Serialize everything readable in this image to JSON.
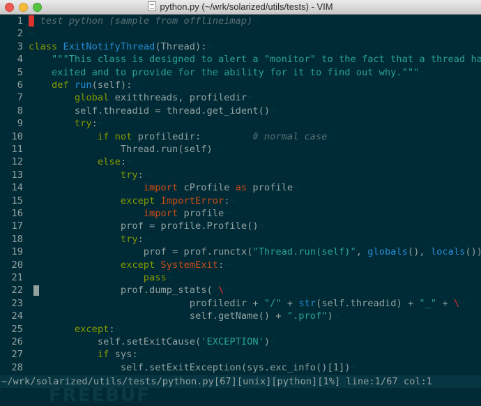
{
  "window": {
    "title": "python.py (~/wrk/solarized/utils/tests) - VIM",
    "file_icon": "document-icon"
  },
  "editor": {
    "lines": [
      {
        "n": "1",
        "segs": [
          [
            "cursor",
            "#"
          ],
          [
            "c",
            " test python (sample from offlineimap)"
          ],
          [
            "nt",
            "¬"
          ]
        ]
      },
      {
        "n": "2",
        "segs": [
          [
            "nt",
            "¬"
          ]
        ]
      },
      {
        "n": "3",
        "segs": [
          [
            "k",
            "class "
          ],
          [
            "f",
            "ExitNotifyThread"
          ],
          [
            "",
            "(Thread):"
          ],
          [
            "nt",
            "¬"
          ]
        ]
      },
      {
        "n": "4",
        "segs": [
          [
            "s",
            "    \"\"\"This class is designed to alert a \"monitor\" to the fact that a thread has"
          ]
        ]
      },
      {
        "n": "5",
        "segs": [
          [
            "s",
            "    exited and to provide for the ability for it to find out why.\"\"\""
          ],
          [
            "nt",
            "¬"
          ]
        ]
      },
      {
        "n": "6",
        "segs": [
          [
            "k",
            "    def "
          ],
          [
            "f",
            "run"
          ],
          [
            "",
            "(self):"
          ],
          [
            "nt",
            "¬"
          ]
        ]
      },
      {
        "n": "7",
        "segs": [
          [
            "k",
            "        global "
          ],
          [
            "",
            "exitthreads, profiledir"
          ],
          [
            "nt",
            "¬"
          ]
        ]
      },
      {
        "n": "8",
        "segs": [
          [
            "",
            "        self.threadid = thread.get_ident()"
          ],
          [
            "nt",
            "¬"
          ]
        ]
      },
      {
        "n": "9",
        "segs": [
          [
            "k",
            "        try"
          ],
          [
            "",
            ":"
          ],
          [
            "nt",
            "¬"
          ]
        ]
      },
      {
        "n": "10",
        "segs": [
          [
            "k",
            "            if not "
          ],
          [
            "",
            "profiledir:         "
          ],
          [
            "c",
            "# normal case"
          ],
          [
            "nt",
            "¬"
          ]
        ]
      },
      {
        "n": "11",
        "segs": [
          [
            "",
            "                Thread.run(self)"
          ],
          [
            "nt",
            "¬"
          ]
        ]
      },
      {
        "n": "12",
        "segs": [
          [
            "k",
            "            else"
          ],
          [
            "",
            ":"
          ],
          [
            "nt",
            "¬"
          ]
        ]
      },
      {
        "n": "13",
        "segs": [
          [
            "k",
            "                try"
          ],
          [
            "",
            ":"
          ],
          [
            "nt",
            "¬"
          ]
        ]
      },
      {
        "n": "14",
        "segs": [
          [
            "e",
            "                    import "
          ],
          [
            "",
            "cProfile "
          ],
          [
            "e",
            "as "
          ],
          [
            "",
            "profile"
          ],
          [
            "nt",
            "¬"
          ]
        ]
      },
      {
        "n": "15",
        "segs": [
          [
            "k",
            "                except "
          ],
          [
            "e",
            "ImportError"
          ],
          [
            "",
            ":"
          ],
          [
            "nt",
            "¬"
          ]
        ]
      },
      {
        "n": "16",
        "segs": [
          [
            "e",
            "                    import "
          ],
          [
            "",
            "profile"
          ],
          [
            "nt",
            "¬"
          ]
        ]
      },
      {
        "n": "17",
        "segs": [
          [
            "",
            "                prof = profile.Profile()"
          ],
          [
            "nt",
            "¬"
          ]
        ]
      },
      {
        "n": "18",
        "segs": [
          [
            "k",
            "                try"
          ],
          [
            "",
            ":"
          ],
          [
            "nt",
            "¬"
          ]
        ]
      },
      {
        "n": "19",
        "segs": [
          [
            "",
            "                    prof = prof.runctx("
          ],
          [
            "s",
            "\"Thread.run(self)\""
          ],
          [
            "",
            ", "
          ],
          [
            "f",
            "globals"
          ],
          [
            "",
            "(), "
          ],
          [
            "f",
            "locals"
          ],
          [
            "",
            "())"
          ]
        ]
      },
      {
        "n": "20",
        "segs": [
          [
            "k",
            "                except "
          ],
          [
            "e",
            "SystemExit"
          ],
          [
            "",
            ":"
          ],
          [
            "nt",
            "¬"
          ]
        ]
      },
      {
        "n": "21",
        "segs": [
          [
            "k",
            "                    pass"
          ],
          [
            "nt",
            "¬"
          ]
        ]
      },
      {
        "n": "22",
        "segs": [
          [
            "",
            "                prof.dump_stats( "
          ],
          [
            "bs",
            "\\"
          ],
          [
            "nt",
            "¬"
          ]
        ]
      },
      {
        "n": "23",
        "segs": [
          [
            "",
            "                            profiledir + "
          ],
          [
            "s",
            "\"/\""
          ],
          [
            "",
            " + "
          ],
          [
            "f",
            "str"
          ],
          [
            "",
            "(self.threadid) + "
          ],
          [
            "s",
            "\"_\""
          ],
          [
            "",
            " + "
          ],
          [
            "bs",
            "\\"
          ],
          [
            "nt",
            "¬"
          ]
        ]
      },
      {
        "n": "24",
        "segs": [
          [
            "",
            "                            self.getName() + "
          ],
          [
            "s",
            "\".prof\""
          ],
          [
            "",
            ")"
          ],
          [
            "nt",
            "¬"
          ]
        ]
      },
      {
        "n": "25",
        "segs": [
          [
            "k",
            "        except"
          ],
          [
            "",
            ":"
          ],
          [
            "nt",
            "¬"
          ]
        ]
      },
      {
        "n": "26",
        "segs": [
          [
            "",
            "            self.setExitCause("
          ],
          [
            "s",
            "'EXCEPTION'"
          ],
          [
            "",
            ")"
          ],
          [
            "nt",
            "¬"
          ]
        ]
      },
      {
        "n": "27",
        "segs": [
          [
            "k",
            "            if "
          ],
          [
            "",
            "sys:"
          ],
          [
            "nt",
            "¬"
          ]
        ]
      },
      {
        "n": "28",
        "segs": [
          [
            "",
            "                self.setExitException(sys.exc_info()[1])"
          ],
          [
            "nt",
            "¬"
          ]
        ]
      }
    ]
  },
  "statusline": {
    "text": "~/wrk/solarized/utils/tests/python.py[67][unix][python][1%] line:1/67 col:1"
  },
  "watermark": {
    "text": "FREEBUF"
  },
  "colors": {
    "background": "#002b36",
    "base1": "#93a1a1",
    "keyword": "#859900",
    "function": "#268bd2",
    "string": "#2aa198",
    "comment": "#586e75",
    "import": "#cb4b16",
    "red": "#dc322f"
  }
}
